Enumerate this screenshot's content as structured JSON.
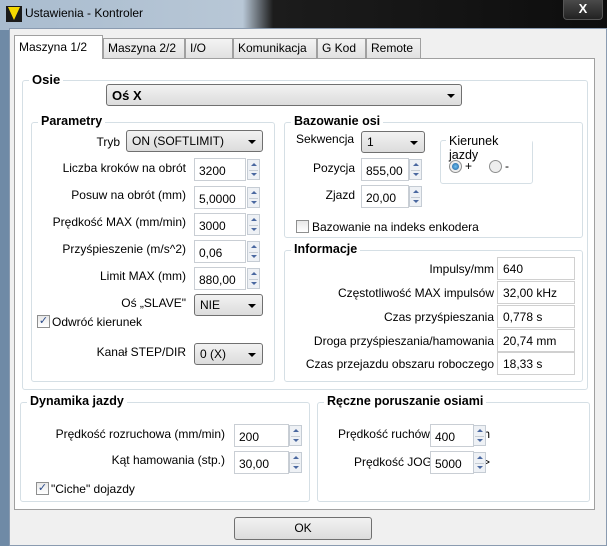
{
  "window": {
    "title": "Ustawienia - Kontroler",
    "close": "X"
  },
  "tabs": [
    "Maszyna 1/2",
    "Maszyna 2/2",
    "I/O",
    "Komunikacja",
    "G Kod",
    "Remote"
  ],
  "osie": {
    "title": "Osie",
    "axis": "Oś X"
  },
  "parametry": {
    "title": "Parametry",
    "tryb_label": "Tryb",
    "tryb": "ON (SOFTLIMIT)",
    "rows": [
      {
        "label": "Liczba kroków na obrót",
        "value": "3200"
      },
      {
        "label": "Posuw na obrót (mm)",
        "value": "5,0000"
      },
      {
        "label": "Prędkość MAX (mm/min)",
        "value": "3000"
      },
      {
        "label": "Przyśpieszenie (m/s^2)",
        "value": "0,06"
      },
      {
        "label": "Limit MAX (mm)",
        "value": "880,00"
      }
    ],
    "slave_label": "Oś „SLAVE\"",
    "slave": "NIE",
    "reverse_label": "Odwróć kierunek",
    "reverse_checked": true,
    "kanal_label": "Kanał STEP/DIR",
    "kanal": "0 (X)"
  },
  "bazowanie": {
    "title": "Bazowanie osi",
    "sekwencja_label": "Sekwencja",
    "sekwencja": "1",
    "pozycja_label": "Pozycja",
    "pozycja": "855,00",
    "zjazd_label": "Zjazd",
    "zjazd": "20,00",
    "kierunek_title": "Kierunek jazdy",
    "plus": "+",
    "minus": "-",
    "selected": "+",
    "enkoder_label": "Bazowanie na indeks enkodera",
    "enkoder_checked": false
  },
  "informacje": {
    "title": "Informacje",
    "rows": [
      {
        "label": "Impulsy/mm",
        "value": "640"
      },
      {
        "label": "Częstotliwość MAX impulsów",
        "value": "32,00 kHz"
      },
      {
        "label": "Czas przyśpieszania",
        "value": "0,778 s"
      },
      {
        "label": "Droga przyśpieszania/hamowania",
        "value": "20,74 mm"
      },
      {
        "label": "Czas przejazdu obszaru roboczego",
        "value": "18,33 s"
      }
    ]
  },
  "dynamika": {
    "title": "Dynamika jazdy",
    "rows": [
      {
        "label": "Prędkość rozruchowa (mm/min)",
        "value": "200"
      },
      {
        "label": "Kąt hamowania (stp.)",
        "value": "30,00"
      }
    ],
    "ciche_label": "\"Ciche\" dojazdy",
    "ciche_checked": true
  },
  "reczne": {
    "title": "Ręczne poruszanie osiami",
    "rows": [
      {
        "label": "Prędkość ruchów krokowych",
        "value": "400"
      },
      {
        "label": "Prędkość  JOG z <CTRL>",
        "value": "5000"
      }
    ]
  },
  "ok": "OK"
}
